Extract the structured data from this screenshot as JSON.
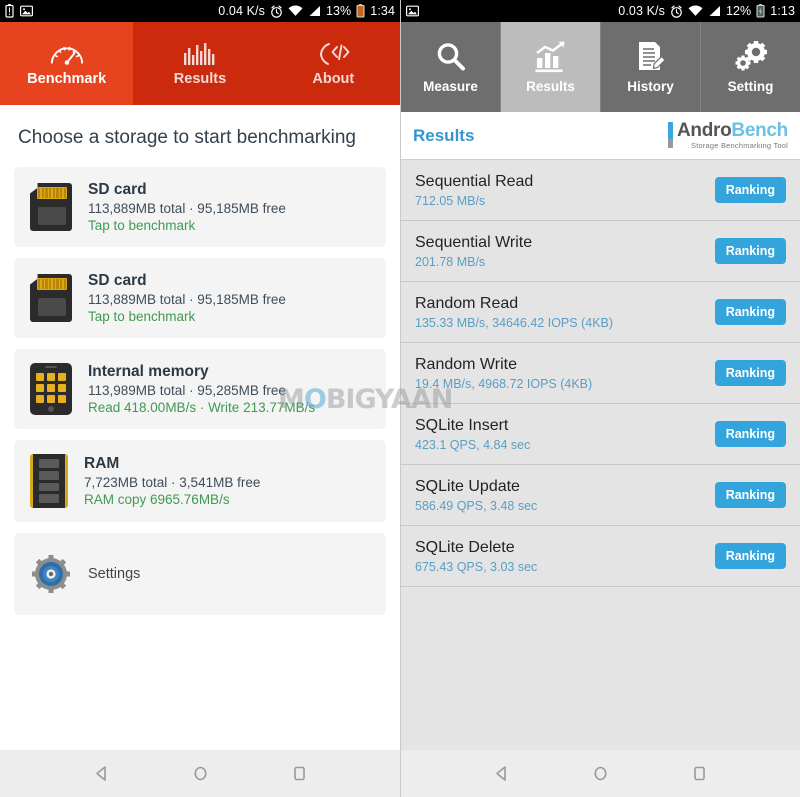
{
  "left_phone": {
    "status_bar": {
      "icons": [
        "battery-alert-icon",
        "image-icon"
      ],
      "net_speed": "0.04 K/s",
      "right_icons": [
        "alarm-icon",
        "wifi-icon",
        "signal-icon"
      ],
      "battery": "13%",
      "time": "1:34"
    },
    "tabs": [
      {
        "label": "Benchmark",
        "icon": "speedometer-icon",
        "active": true
      },
      {
        "label": "Results",
        "icon": "bar-chart-icon",
        "active": false
      },
      {
        "label": "About",
        "icon": "code-bracket-icon",
        "active": false
      }
    ],
    "title": "Choose a storage to start benchmarking",
    "storage_items": [
      {
        "icon": "sd-card-icon",
        "name": "SD card",
        "capacity": "113,889MB total · 95,185MB free",
        "status": "Tap to benchmark"
      },
      {
        "icon": "sd-card-icon",
        "name": "SD card",
        "capacity": "113,889MB total · 95,185MB free",
        "status": "Tap to benchmark"
      },
      {
        "icon": "internal-memory-icon",
        "name": "Internal memory",
        "capacity": "113,989MB total · 95,285MB free",
        "status": "Read 418.00MB/s · Write 213.77MB/s"
      },
      {
        "icon": "ram-chip-icon",
        "name": "RAM",
        "capacity": "7,723MB total · 3,541MB free",
        "status": "RAM copy 6965.76MB/s"
      }
    ],
    "settings": {
      "icon": "gear-icon",
      "label": "Settings"
    },
    "nav": [
      "back-button",
      "home-button",
      "recents-button"
    ],
    "colors": {
      "tab_active": "#e8431f",
      "tab_inactive": "#cc2a0c",
      "stat_green": "#3f9a51"
    }
  },
  "right_phone": {
    "status_bar": {
      "icons": [
        "image-icon"
      ],
      "net_speed": "0.03 K/s",
      "right_icons": [
        "alarm-icon",
        "wifi-icon",
        "signal-icon"
      ],
      "battery": "12%",
      "time": "1:13"
    },
    "tabs": [
      {
        "label": "Measure",
        "icon": "magnifier-icon",
        "active": false
      },
      {
        "label": "Results",
        "icon": "growth-chart-icon",
        "active": true
      },
      {
        "label": "History",
        "icon": "document-edit-icon",
        "active": false
      },
      {
        "label": "Setting",
        "icon": "gears-icon",
        "active": false
      }
    ],
    "header": {
      "title": "Results",
      "logo_andro": "Andro",
      "logo_bench": "Bench",
      "logo_tagline": "Storage Benchmarking Tool"
    },
    "results": [
      {
        "name": "Sequential Read",
        "value": "712.05 MB/s",
        "button": "Ranking"
      },
      {
        "name": "Sequential Write",
        "value": "201.78 MB/s",
        "button": "Ranking"
      },
      {
        "name": "Random Read",
        "value": "135.33 MB/s, 34646.42 IOPS (4KB)",
        "button": "Ranking"
      },
      {
        "name": "Random Write",
        "value": "19.4 MB/s, 4968.72 IOPS (4KB)",
        "button": "Ranking"
      },
      {
        "name": "SQLite Insert",
        "value": "423.1 QPS, 4.84 sec",
        "button": "Ranking"
      },
      {
        "name": "SQLite Update",
        "value": "586.49 QPS, 3.48 sec",
        "button": "Ranking"
      },
      {
        "name": "SQLite Delete",
        "value": "675.43 QPS, 3.03 sec",
        "button": "Ranking"
      }
    ],
    "nav": [
      "back-button",
      "home-button",
      "recents-button"
    ],
    "colors": {
      "tab_active": "#bcbcbc",
      "tab_inactive": "#6e6e6e",
      "accent_blue": "#33a5dc"
    }
  },
  "watermark": {
    "part1": "M",
    "part2": "O",
    "part3": "BIGYAAN"
  }
}
